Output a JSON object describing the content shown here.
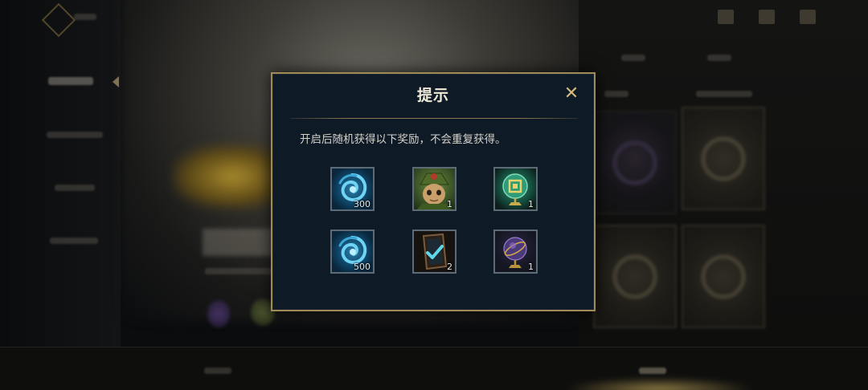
{
  "modal": {
    "title": "提示",
    "close_glyph": "✕",
    "description": "开启后随机获得以下奖励，不会重复获得。",
    "rewards": [
      {
        "icon": "blue-swirl-icon",
        "count": "300"
      },
      {
        "icon": "teemo-portrait-icon",
        "count": "1"
      },
      {
        "icon": "green-trophy-icon",
        "count": "1"
      },
      {
        "icon": "blue-swirl-icon",
        "count": "500"
      },
      {
        "icon": "check-card-icon",
        "count": "2"
      },
      {
        "icon": "purple-orb-trophy-icon",
        "count": "1"
      }
    ]
  },
  "colors": {
    "modal_bg": "#0f1a27",
    "modal_border": "#a08a55",
    "accent_gold": "#d3bb7a",
    "text": "#d4d2cb"
  }
}
